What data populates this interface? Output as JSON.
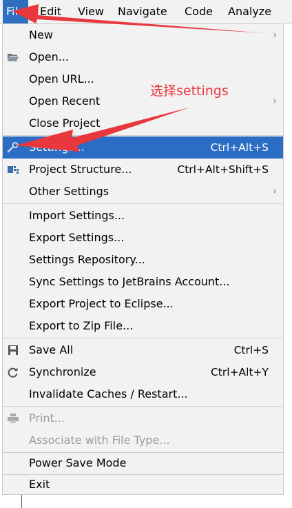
{
  "menubar": {
    "items": [
      "File",
      "Edit",
      "View",
      "Navigate",
      "Code",
      "Analyze"
    ]
  },
  "menu": {
    "new": "New",
    "open": "Open...",
    "open_url": "Open URL...",
    "open_recent": "Open Recent",
    "close_project": "Close Project",
    "settings": "Settings...",
    "settings_shortcut": "Ctrl+Alt+S",
    "project_structure": "Project Structure...",
    "project_structure_shortcut": "Ctrl+Alt+Shift+S",
    "other_settings": "Other Settings",
    "import_settings": "Import Settings...",
    "export_settings": "Export Settings...",
    "settings_repository": "Settings Repository...",
    "sync_settings": "Sync Settings to JetBrains Account...",
    "export_eclipse": "Export Project to Eclipse...",
    "export_zip": "Export to Zip File...",
    "save_all": "Save All",
    "save_all_shortcut": "Ctrl+S",
    "synchronize": "Synchronize",
    "synchronize_shortcut": "Ctrl+Alt+Y",
    "invalidate": "Invalidate Caches / Restart...",
    "print": "Print...",
    "associate": "Associate with File Type...",
    "power_save": "Power Save Mode",
    "exit": "Exit"
  },
  "annotation": {
    "text": "选择settings",
    "color": "#e8383d"
  },
  "colors": {
    "highlight": "#2b6cc4",
    "menu_bg": "#f2f2f2",
    "disabled": "#9a9a9a"
  },
  "icons": [
    "folder-icon",
    "wrench-icon",
    "project-structure-icon",
    "save-icon",
    "sync-icon",
    "printer-icon"
  ]
}
